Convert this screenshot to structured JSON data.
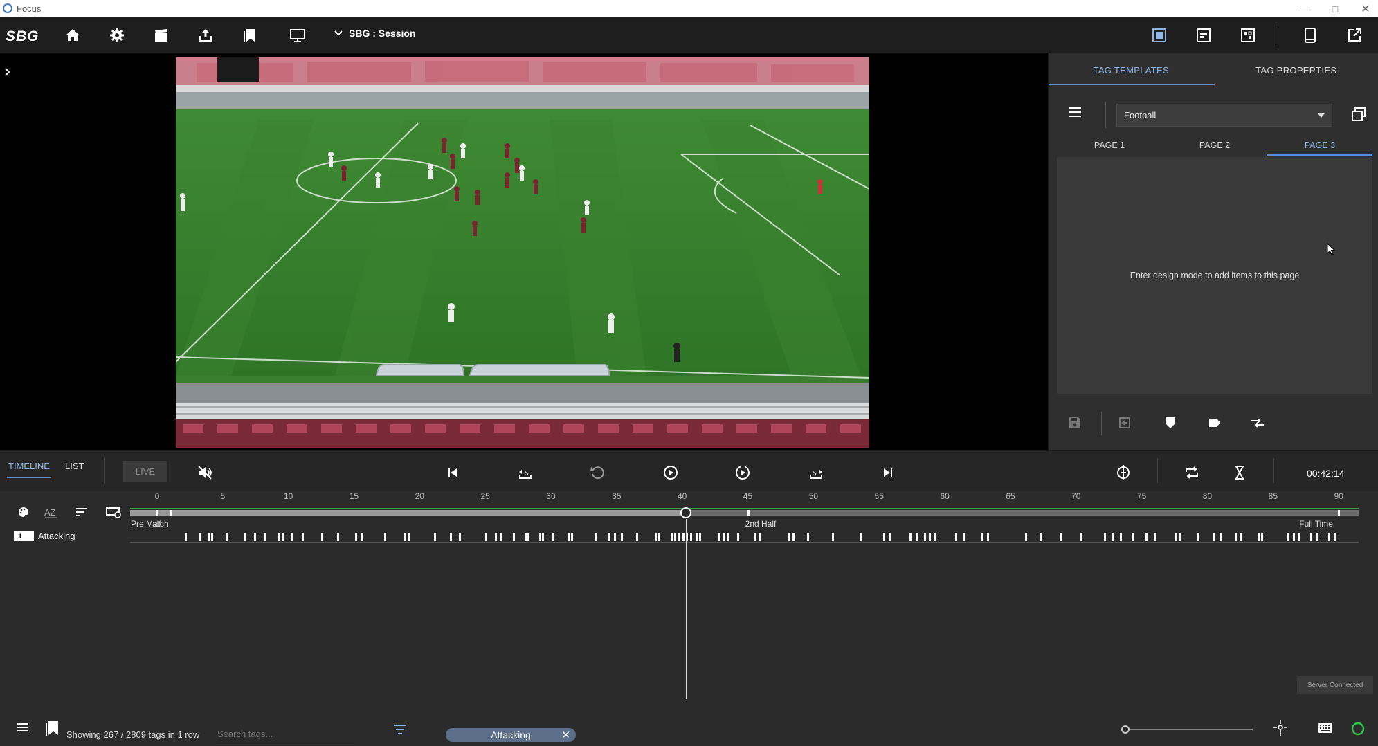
{
  "window": {
    "title": "Focus"
  },
  "toolbar": {
    "logo": "SBG",
    "session_label": "SBG : Session",
    "left_icons": [
      "home-icon",
      "settings-icon",
      "clapperboard-icon",
      "upload-icon",
      "bookmarks-icon",
      "monitor-icon"
    ],
    "right_icons": [
      "layout-single-icon",
      "layout-split-icon",
      "layout-grid-icon",
      "tablet-icon",
      "external-link-icon"
    ]
  },
  "right_panel": {
    "tabs": [
      {
        "label": "TAG TEMPLATES",
        "active": true
      },
      {
        "label": "TAG PROPERTIES",
        "active": false
      }
    ],
    "template_select": "Football",
    "pages": [
      {
        "label": "PAGE 1",
        "active": false
      },
      {
        "label": "PAGE 2",
        "active": false
      },
      {
        "label": "PAGE 3",
        "active": true
      }
    ],
    "empty_message": "Enter design mode to add items to this page"
  },
  "transport": {
    "tabs": [
      {
        "label": "TIMELINE",
        "active": true
      },
      {
        "label": "LIST",
        "active": false
      }
    ],
    "live_label": "LIVE",
    "skip_back_label": "5",
    "skip_forward_label": "5",
    "time": "00:42:14"
  },
  "timeline": {
    "ticks": [
      "0",
      "5",
      "10",
      "15",
      "20",
      "25",
      "30",
      "35",
      "40",
      "45",
      "50",
      "55",
      "60",
      "65",
      "70",
      "75",
      "80",
      "85",
      "90"
    ],
    "playhead_minute": 40.3,
    "periods": [
      {
        "label": "Pre Match",
        "minute": 0
      },
      {
        "label": "alf",
        "minute": 1
      },
      {
        "label": "2nd Half",
        "minute": 45
      },
      {
        "label": "Full Time",
        "minute": 90
      }
    ],
    "rows": [
      {
        "number": "1",
        "label": "Attacking"
      }
    ],
    "tag_minutes": [
      2.1,
      3.2,
      3.9,
      4.1,
      5.2,
      6.6,
      7.4,
      8.1,
      9.2,
      9.5,
      10.2,
      11.0,
      12.5,
      13.7,
      15.1,
      15.5,
      17.3,
      18.8,
      19.1,
      21.1,
      22.3,
      23.0,
      25.0,
      25.7,
      26.1,
      27.1,
      28.0,
      28.2,
      29.1,
      29.3,
      30.1,
      31.3,
      31.5,
      33.3,
      34.3,
      34.8,
      35.3,
      36.5,
      37.9,
      38.1,
      39.1,
      39.4,
      39.7,
      40.0,
      40.3,
      40.6,
      41.0,
      41.3,
      42.7,
      43.1,
      43.4,
      44.2,
      45.5,
      45.8,
      48.1,
      48.4,
      49.5,
      51.4,
      53.5,
      55.3,
      55.7,
      57.3,
      57.8,
      58.4,
      58.8,
      59.2,
      60.8,
      61.4,
      62.8,
      63.2,
      66.1,
      67.2,
      68.8,
      70.3,
      72.1,
      72.7,
      73.3,
      74.3,
      75.3,
      75.9,
      77.5,
      77.8,
      79.2,
      80.4,
      80.9,
      82.1,
      82.5,
      83.8,
      84.1,
      86.1,
      86.5,
      86.9,
      87.8,
      88.3,
      89.2,
      89.6
    ],
    "tools": [
      "palette-icon",
      "sort-az-icon",
      "sort-icon",
      "row-settings-icon"
    ]
  },
  "status": {
    "text": "Showing 267 / 2809 tags in 1 row",
    "search_placeholder": "Search tags...",
    "active_filter": "Attacking",
    "server_status": "Server Connected",
    "zoom_level": 0
  }
}
